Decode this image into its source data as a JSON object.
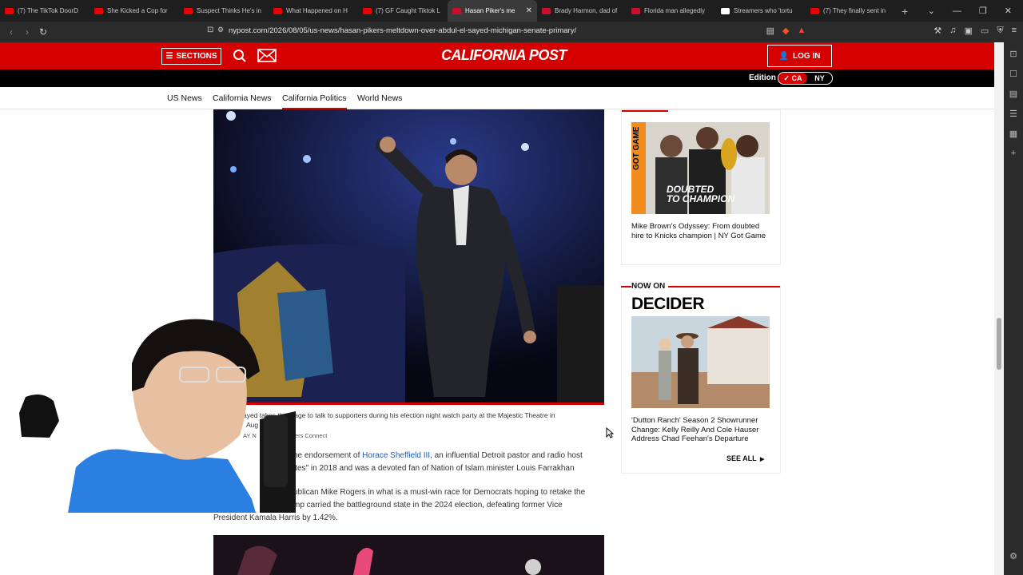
{
  "browser": {
    "tabs": [
      {
        "title": "(7) The TikTok DoorD",
        "favicon": "youtube",
        "active": false
      },
      {
        "title": "She Kicked a Cop for",
        "favicon": "youtube",
        "active": false
      },
      {
        "title": "Suspect Thinks He's in",
        "favicon": "youtube",
        "active": false
      },
      {
        "title": "What Happened on H",
        "favicon": "youtube",
        "active": false
      },
      {
        "title": "(7) GF Caught Tiktok L",
        "favicon": "youtube",
        "active": false
      },
      {
        "title": "Hasan Piker's me",
        "favicon": "nypost",
        "active": true
      },
      {
        "title": "Brady Harmon, dad of",
        "favicon": "nypost",
        "active": false
      },
      {
        "title": "Florida man allegedly",
        "favicon": "nypost",
        "active": false
      },
      {
        "title": "Streamers who 'tortu",
        "favicon": "twitch",
        "active": false
      },
      {
        "title": "(7) They finally sent in",
        "favicon": "youtube",
        "active": false
      }
    ],
    "new_tab": "+",
    "url": "nypost.com/2026/08/05/us-news/hasan-pikers-meltdown-over-abdul-el-sayed-michigan-senate-primary/"
  },
  "site": {
    "sections_label": "SECTIONS",
    "logo": "CALIFORNIA POST",
    "login_label": "LOG IN",
    "edition_label": "Edition",
    "edition_ca": "✓ CA",
    "edition_ny": "NY",
    "subnav": [
      "US News",
      "California News",
      "California Politics",
      "World News"
    ],
    "subnav_active": "California Politics",
    "brand_red": "#d50000"
  },
  "article": {
    "caption_line1": "ayed takes the stage to talk to supporters during his election night watch party at the Majestic Theatre in",
    "caption_line2": "Aug",
    "caption_line2b": "6",
    "credit_a": "AY N",
    "credit_b": "ers Connect",
    "para1_prefix": "he endorsement of",
    "para1_link": "Horace Sheffield III",
    "para1_rest": ", an influential Detroit pastor and radio host",
    "para1_line2": "ites\" in 2018 and was a devoted fan of Nation of Islam minister Louis Farrakhan",
    "para2_line1": "ublican Mike Rogers in what is a must-win race for Democrats hoping to retake the",
    "para2_line2": "mp carried the battleground state in the 2024 election, defeating former Vice",
    "para2_line3": "President Kamala Harris by 1.42%."
  },
  "rail": {
    "card1_title": "Mike Brown's Odyssey: From doubted hire to Knicks champion | NY Got Game",
    "card1_img_text_a": "DOUBTED",
    "card1_img_text_b": "TO CHAMPION",
    "card1_img_badge": "GOT GAME",
    "now_on": "NOW ON",
    "decider": "DECIDER",
    "card2_title": "'Dutton Ranch' Season 2 Showrunner Change: Kelly Reilly And Cole Hauser Address Chad Feehan's Departure",
    "see_all": "SEE ALL"
  }
}
